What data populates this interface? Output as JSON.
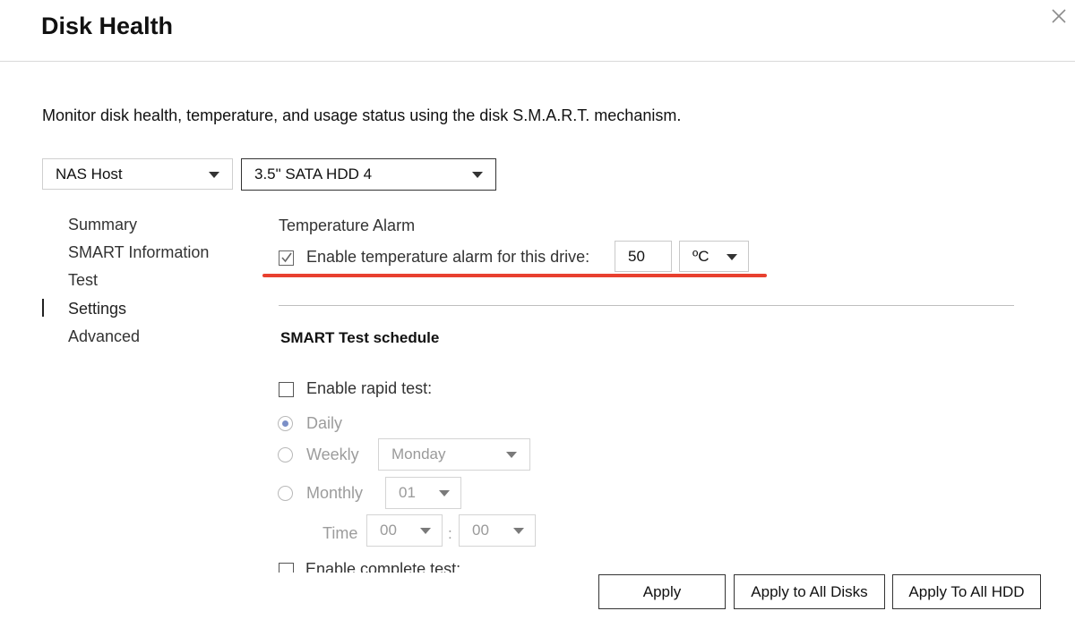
{
  "dialog": {
    "title": "Disk Health",
    "description": "Monitor disk health, temperature, and usage status using the disk S.M.A.R.T. mechanism."
  },
  "selectors": {
    "host": "NAS Host",
    "disk": "3.5\" SATA HDD 4"
  },
  "sidebar": {
    "items": [
      {
        "label": "Summary"
      },
      {
        "label": "SMART Information"
      },
      {
        "label": "Test"
      },
      {
        "label": "Settings",
        "active": true
      },
      {
        "label": "Advanced"
      }
    ]
  },
  "temperature_alarm": {
    "heading": "Temperature Alarm",
    "checkbox_label": "Enable temperature alarm for this drive:",
    "checked": true,
    "value": "50",
    "unit": "ºC"
  },
  "smart_schedule": {
    "heading": "SMART Test schedule",
    "rapid_label": "Enable rapid test:",
    "rapid_checked": false,
    "daily_label": "Daily",
    "weekly_label": "Weekly",
    "weekly_day": "Monday",
    "monthly_label": "Monthly",
    "monthly_day": "01",
    "time_label": "Time",
    "hour": "00",
    "time_separator": ":",
    "minute": "00",
    "complete_label": "Enable complete test:"
  },
  "footer": {
    "apply": "Apply",
    "apply_all_disks": "Apply to All Disks",
    "apply_all_hdd": "Apply To All HDD"
  },
  "colors": {
    "highlight_underline": "#e8402f",
    "radio_selected": "#7b8fc7"
  }
}
